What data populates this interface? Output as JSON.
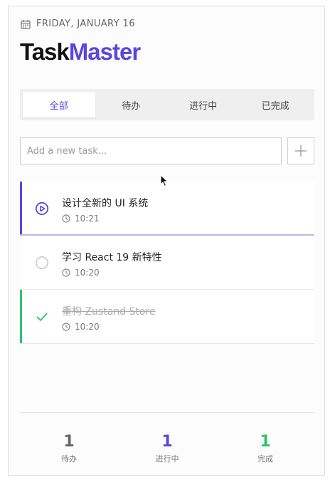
{
  "header": {
    "date": "FRIDAY, JANUARY 16",
    "brand_part1": "Task",
    "brand_part2": "Master"
  },
  "tabs": [
    {
      "label": "全部",
      "active": true
    },
    {
      "label": "待办",
      "active": false
    },
    {
      "label": "进行中",
      "active": false
    },
    {
      "label": "已完成",
      "active": false
    }
  ],
  "new_task": {
    "placeholder": "Add a new task...",
    "value": ""
  },
  "tasks": [
    {
      "title": "设计全新的 UI 系统",
      "time": "10:21",
      "status": "in-progress"
    },
    {
      "title": "学习 React 19 新特性",
      "time": "10:20",
      "status": "todo"
    },
    {
      "title": "重构 Zustand Store",
      "time": "10:20",
      "status": "done"
    }
  ],
  "stats": [
    {
      "count": "1",
      "label": "待办"
    },
    {
      "count": "1",
      "label": "进行中"
    },
    {
      "count": "1",
      "label": "完成"
    }
  ],
  "colors": {
    "accent": "#5a46e0",
    "done": "#2ec26b",
    "muted": "#666666"
  }
}
